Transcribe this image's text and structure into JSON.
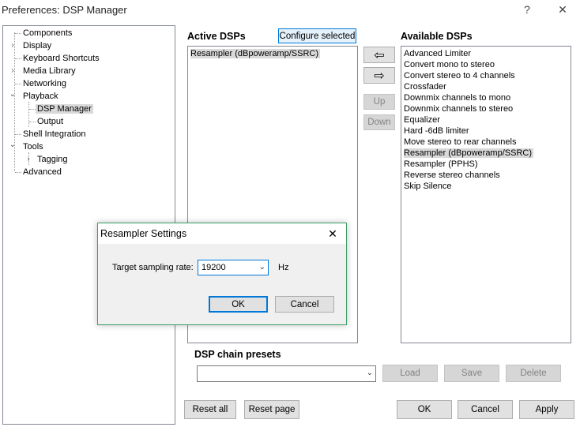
{
  "window": {
    "title": "Preferences: DSP Manager",
    "help": "?",
    "close": "✕"
  },
  "tree": {
    "items": [
      {
        "label": "Components",
        "expander": ""
      },
      {
        "label": "Display",
        "expander": "›"
      },
      {
        "label": "Keyboard Shortcuts",
        "expander": ""
      },
      {
        "label": "Media Library",
        "expander": "›"
      },
      {
        "label": "Networking",
        "expander": ""
      },
      {
        "label": "Playback",
        "expander": "⌄"
      },
      {
        "label": "DSP Manager",
        "expander": ""
      },
      {
        "label": "Output",
        "expander": ""
      },
      {
        "label": "Shell Integration",
        "expander": ""
      },
      {
        "label": "Tools",
        "expander": "⌄"
      },
      {
        "label": "Tagging",
        "expander": "›"
      },
      {
        "label": "Advanced",
        "expander": ""
      }
    ]
  },
  "active": {
    "title": "Active DSPs",
    "configure_label": "Configure selected",
    "items": [
      "Resampler (dBpoweramp/SSRC)"
    ]
  },
  "middle": {
    "left_arrow": "⇦",
    "right_arrow": "⇨",
    "up_label": "Up",
    "down_label": "Down"
  },
  "available": {
    "title": "Available DSPs",
    "items": [
      "Advanced Limiter",
      "Convert mono to stereo",
      "Convert stereo to 4 channels",
      "Crossfader",
      "Downmix channels to mono",
      "Downmix channels to stereo",
      "Equalizer",
      "Hard -6dB limiter",
      "Move stereo to rear channels",
      "Resampler (dBpoweramp/SSRC)",
      "Resampler (PPHS)",
      "Reverse stereo channels",
      "Skip Silence"
    ]
  },
  "presets": {
    "title": "DSP chain presets",
    "combo_value": "",
    "load_label": "Load",
    "save_label": "Save",
    "delete_label": "Delete"
  },
  "footer": {
    "reset_all_label": "Reset all",
    "reset_page_label": "Reset page",
    "ok_label": "OK",
    "cancel_label": "Cancel",
    "apply_label": "Apply"
  },
  "dialog": {
    "title": "Resampler Settings",
    "close": "✕",
    "rate_label": "Target sampling rate:",
    "rate_value": "19200",
    "unit": "Hz",
    "ok_label": "OK",
    "cancel_label": "Cancel"
  },
  "colors": {
    "accent": "#0078d7",
    "dialog_border": "#3c9f6a",
    "selection": "#d9d9d9"
  }
}
